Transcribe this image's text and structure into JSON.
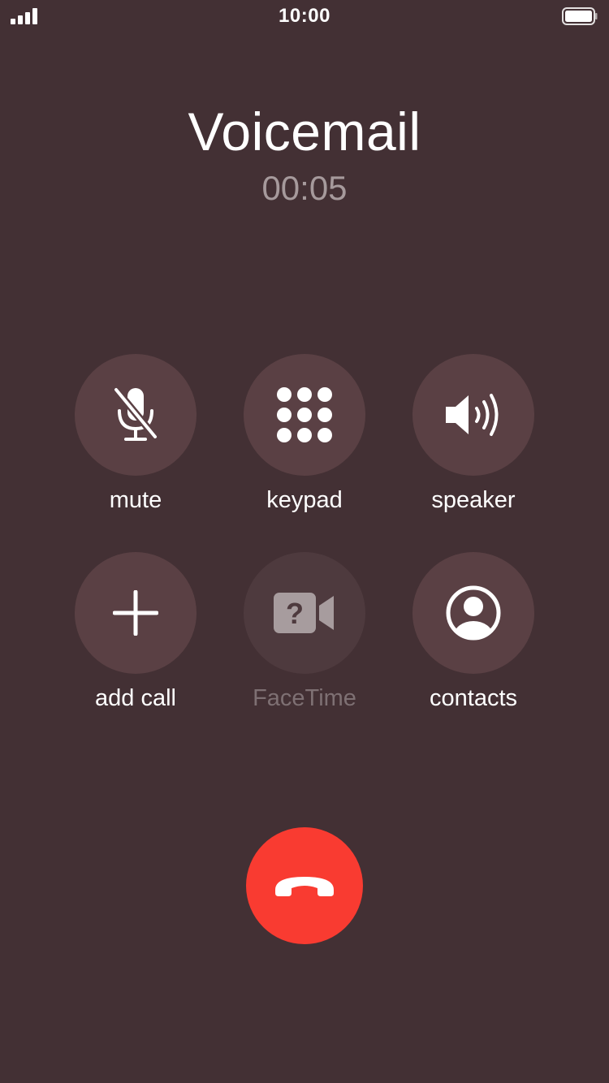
{
  "status_bar": {
    "time": "10:00",
    "signal_icon": "cellular-signal-icon",
    "battery_icon": "battery-full-icon"
  },
  "call": {
    "contact_name": "Voicemail",
    "duration": "00:05"
  },
  "controls": {
    "mute": {
      "label": "mute",
      "icon": "microphone-slash-icon",
      "enabled": true
    },
    "keypad": {
      "label": "keypad",
      "icon": "keypad-icon",
      "enabled": true
    },
    "speaker": {
      "label": "speaker",
      "icon": "speaker-icon",
      "enabled": true
    },
    "add_call": {
      "label": "add call",
      "icon": "plus-icon",
      "enabled": true
    },
    "facetime": {
      "label": "FaceTime",
      "icon": "facetime-unavailable-icon",
      "enabled": false
    },
    "contacts": {
      "label": "contacts",
      "icon": "contact-person-icon",
      "enabled": true
    }
  },
  "end_call": {
    "icon": "phone-hangup-icon"
  },
  "colors": {
    "background": "#433034",
    "button": "#5a4044",
    "button_disabled": "#4e3a3e",
    "end_call": "#f93b31",
    "timer_text": "#a69a9c",
    "disabled_text": "#7e7073"
  }
}
